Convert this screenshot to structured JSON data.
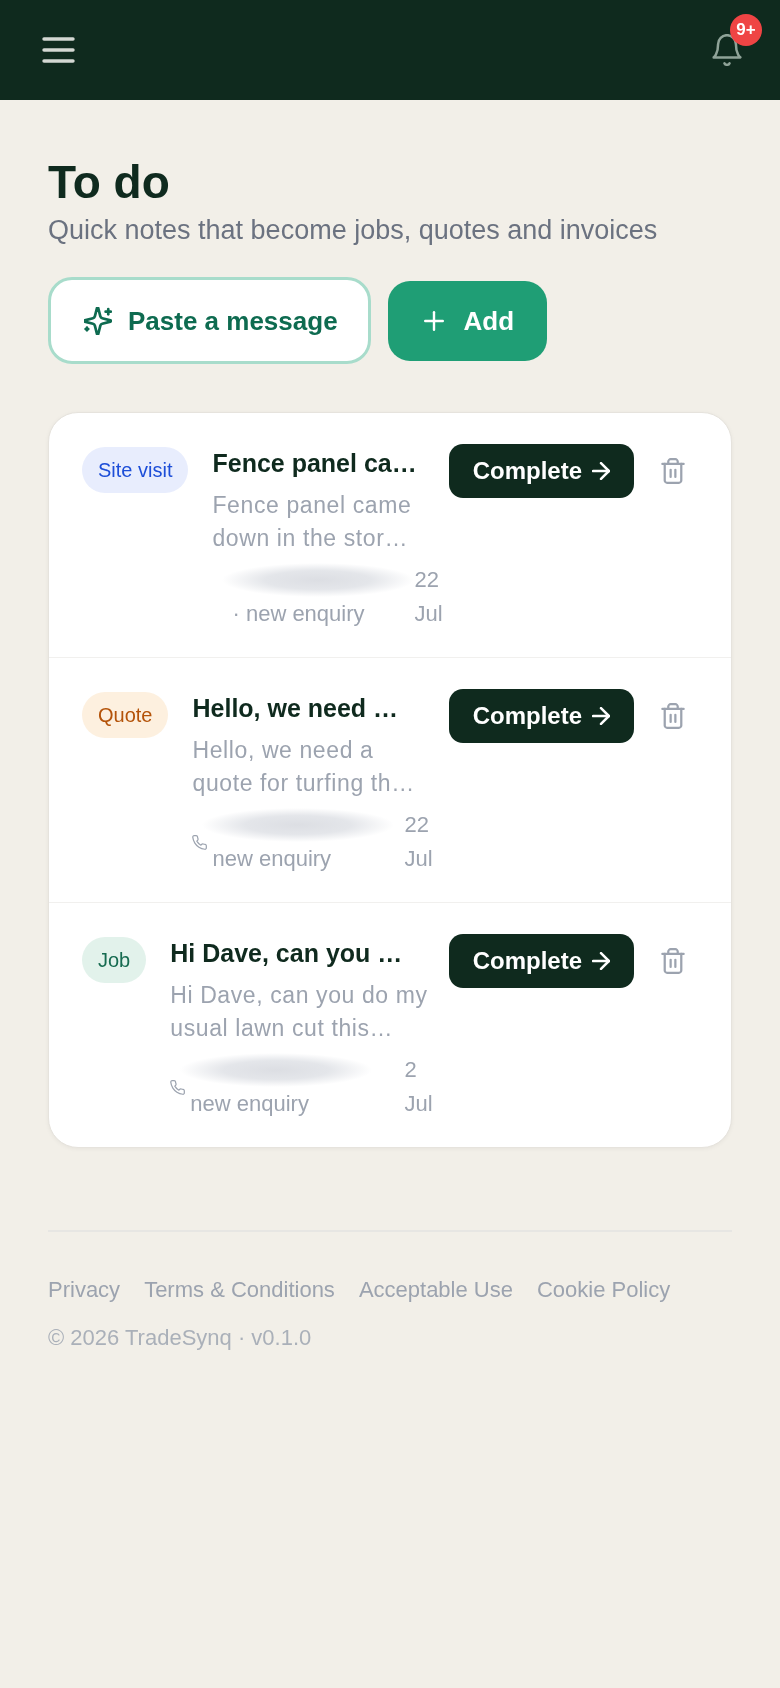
{
  "header": {
    "notification_badge": "9+"
  },
  "intro": {
    "title": "To do",
    "subtitle": "Quick notes that become jobs, quotes and invoices"
  },
  "actions": [
    {
      "kind": "paste",
      "label": "Paste a message"
    },
    {
      "kind": "add",
      "label": "Add"
    }
  ],
  "todos": [
    {
      "tag": {
        "kind": "site_visit",
        "label": "Site visit"
      },
      "title": "Fence panel ca…",
      "preview": "Fence panel came down in the stor…",
      "contact": {
        "phone_icon": false,
        "redacted": true,
        "note": "· new enquiry"
      },
      "date": "22 Jul",
      "action": "Complete"
    },
    {
      "tag": {
        "kind": "quote",
        "label": "Quote"
      },
      "title": "Hello, we need …",
      "preview": "Hello, we need a quote for turfing th…",
      "contact": {
        "phone_icon": true,
        "redacted": true,
        "note": "new enquiry"
      },
      "date": "22 Jul",
      "action": "Complete"
    },
    {
      "tag": {
        "kind": "job",
        "label": "Job"
      },
      "title": "Hi Dave, can you …",
      "preview": "Hi Dave, can you do my usual lawn cut this…",
      "contact": {
        "phone_icon": true,
        "redacted": true,
        "note": "new enquiry"
      },
      "date": "2 Jul",
      "action": "Complete"
    }
  ],
  "footer": {
    "links": [
      "Privacy",
      "Terms & Conditions",
      "Acceptable Use",
      "Cookie Policy"
    ],
    "copyright": "© 2026 TradeSynq · v0.1.0"
  }
}
